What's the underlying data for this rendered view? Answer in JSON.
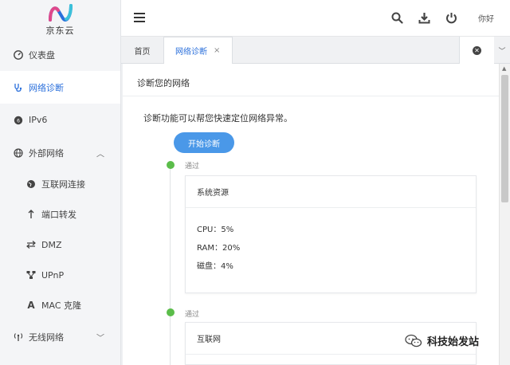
{
  "logo": {
    "text": "京东云"
  },
  "sidebar": {
    "items": [
      {
        "label": "仪表盘",
        "icon": "gauge-icon"
      },
      {
        "label": "网络诊断",
        "icon": "stethoscope-icon",
        "active": true
      },
      {
        "label": "IPv6",
        "icon": "ipv6-icon"
      },
      {
        "label": "外部网络",
        "icon": "globe-icon",
        "expanded": true
      },
      {
        "label": "互联网连接",
        "icon": "internet-icon",
        "sub": true
      },
      {
        "label": "端口转发",
        "icon": "arrow-up-icon",
        "sub": true
      },
      {
        "label": "DMZ",
        "icon": "swap-icon",
        "sub": true
      },
      {
        "label": "UPnP",
        "icon": "network-icon",
        "sub": true
      },
      {
        "label": "MAC 克隆",
        "icon": "letter-a-icon",
        "sub": true
      },
      {
        "label": "无线网络",
        "icon": "wifi-icon",
        "expanded": false
      }
    ]
  },
  "header": {
    "user": "你好"
  },
  "tabs": {
    "home": "首页",
    "active": "网络诊断",
    "close": "×"
  },
  "main": {
    "title": "诊断您的网络",
    "description": "诊断功能可以帮您快速定位网络异常。",
    "start_button": "开始诊断",
    "steps": [
      {
        "status": "通过",
        "card_title": "系统资源",
        "stats": [
          "CPU：5%",
          "RAM：20%",
          "磁盘：4%"
        ]
      },
      {
        "status": "通过",
        "card_title": "互联网"
      }
    ]
  },
  "watermark": {
    "text": "科技始发站"
  },
  "colors": {
    "accent": "#2a6fdb",
    "button": "#4a98e8",
    "success": "#5bbd4a"
  }
}
